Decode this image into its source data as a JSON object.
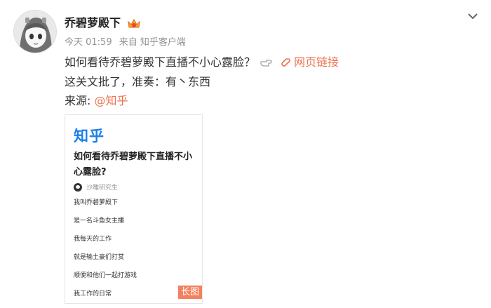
{
  "post": {
    "username": "乔碧萝殿下",
    "time": "今天 01:59",
    "source": "来自 知乎客户端",
    "line1": "如何看待乔碧萝殿下直播不小心露脸？",
    "web_link_label": "网页链接",
    "line2": "这关文批了，准奏：有丶东西",
    "source_label": "来源: ",
    "mention": "@知乎"
  },
  "card": {
    "logo": "知乎",
    "title": "如何看待乔碧萝殿下直播不小心露脸?",
    "author": "沙雕研究生",
    "lines": [
      "我叫乔碧萝殿下",
      "是一名斗鱼女主播",
      "我每天的工作",
      "就是输土豪们打赏",
      "顺便和他们一起打游戏",
      "我工作的日常"
    ],
    "badge": "长图"
  },
  "colors": {
    "link": "#eb7350",
    "zhihu_blue": "#1a7fe6",
    "badge_bg": "#f3805e"
  },
  "icons": [
    "avatar-illustration",
    "vip-crown-icon",
    "chevron-down-icon",
    "pointing-hand-icon",
    "link-icon"
  ]
}
